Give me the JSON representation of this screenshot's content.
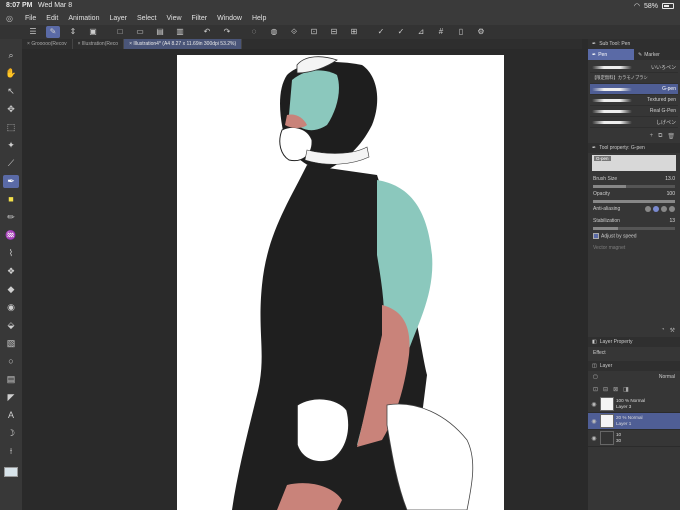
{
  "status": {
    "time": "8:07 PM",
    "date": "Wed Mar 8",
    "battery": "58%"
  },
  "menu": [
    "File",
    "Edit",
    "Animation",
    "Layer",
    "Select",
    "View",
    "Filter",
    "Window",
    "Help"
  ],
  "tabs": [
    {
      "label": "Grooooo(Recov",
      "active": false
    },
    {
      "label": "Illustration(Reco",
      "active": false
    },
    {
      "label": "Illustration4* (A4 8.27 x 11.69in 300dpi 53.2%)",
      "active": true
    }
  ],
  "subtool_panel": {
    "title": "Sub Tool: Pen",
    "tabs": [
      "Pen",
      "Marker"
    ],
    "brushes": [
      {
        "name": "いいろペン",
        "active": false
      },
      {
        "name": "【限定無料】カラモノブラシ",
        "active": false
      },
      {
        "name": "G-pen",
        "active": true
      },
      {
        "name": "Textured pen",
        "active": false
      },
      {
        "name": "Real G-Pen",
        "active": false
      },
      {
        "name": "しげペン",
        "active": false
      }
    ]
  },
  "tool_property": {
    "title": "Tool property: G-pen",
    "preview_label": "G-pen",
    "brush_size_label": "Brush Size",
    "brush_size_value": "13.0",
    "opacity_label": "Opacity",
    "opacity_value": "100",
    "antialiasing_label": "Anti-aliasing",
    "stabilization_label": "Stabilization",
    "stabilization_value": "13",
    "adjust_by_speed_label": "Adjust by speed",
    "vector_magnet_label": "Vector magnet"
  },
  "layer_property": {
    "title": "Layer Property",
    "effect_label": "Effect"
  },
  "layer_panel": {
    "title": "Layer",
    "blend_mode": "Normal",
    "layers": [
      {
        "percent": "100 %",
        "mode": "Normal",
        "name": "Layer 3",
        "active": false
      },
      {
        "percent": "20 %",
        "mode": "Normal",
        "name": "Layer 1",
        "active": true
      },
      {
        "percent": "10",
        "mode": "",
        "name": "30",
        "active": false
      }
    ]
  }
}
